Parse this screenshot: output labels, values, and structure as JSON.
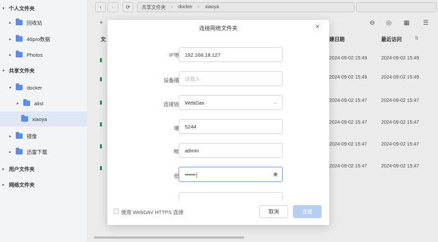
{
  "sidebar": {
    "personal": "个人文件夹",
    "recycle": "回收站",
    "data46": "46pro数据",
    "photos": "Photos",
    "shared": "共享文件夹",
    "docker": "docker",
    "alist": "alist",
    "xiaoya": "xiaoya",
    "mirror": "镜像",
    "thunder": "迅雷下载",
    "user": "用户文件夹",
    "network": "网络文件夹"
  },
  "breadcrumb": {
    "shared": "共享文件夹",
    "docker": "docker",
    "xiaoya": "xiaoya"
  },
  "columns": {
    "name_partial": "文",
    "created_partial": "建日期",
    "recent": "最近访问"
  },
  "rows": [
    {
      "created": "2024-09-02 15:49",
      "recent": "2024-09-02 15:49"
    },
    {
      "created": "2024-09-02 15:49",
      "recent": "2024-09-02 15:49"
    },
    {
      "created": "2024-09-02 15:47",
      "recent": "2024-09-02 15:47"
    },
    {
      "created": "2024-09-02 15:47",
      "recent": "2024-09-02 15:47"
    },
    {
      "created": "2024-09-02 15:47",
      "recent": "2024-09-02 15:47"
    },
    {
      "created": "2024-09-02 15:47",
      "recent": "2024-09-02 15:47"
    }
  ],
  "dialog": {
    "title": "连接网络文件夹",
    "ip_label": "IP地址",
    "ip_value": "192.168.18.127",
    "desc_label": "设备描述",
    "desc_placeholder": "请输入",
    "protocol_label": "连接协议",
    "protocol_value": "WebDav",
    "port_label": "端口",
    "port_value": "5244",
    "account_label": "帐号",
    "account_value": "admin",
    "password_label": "密码",
    "password_value": "••••••",
    "https_label": "使用 WebDAV HTTPS 连接",
    "cancel": "取消",
    "ok": "连接"
  }
}
